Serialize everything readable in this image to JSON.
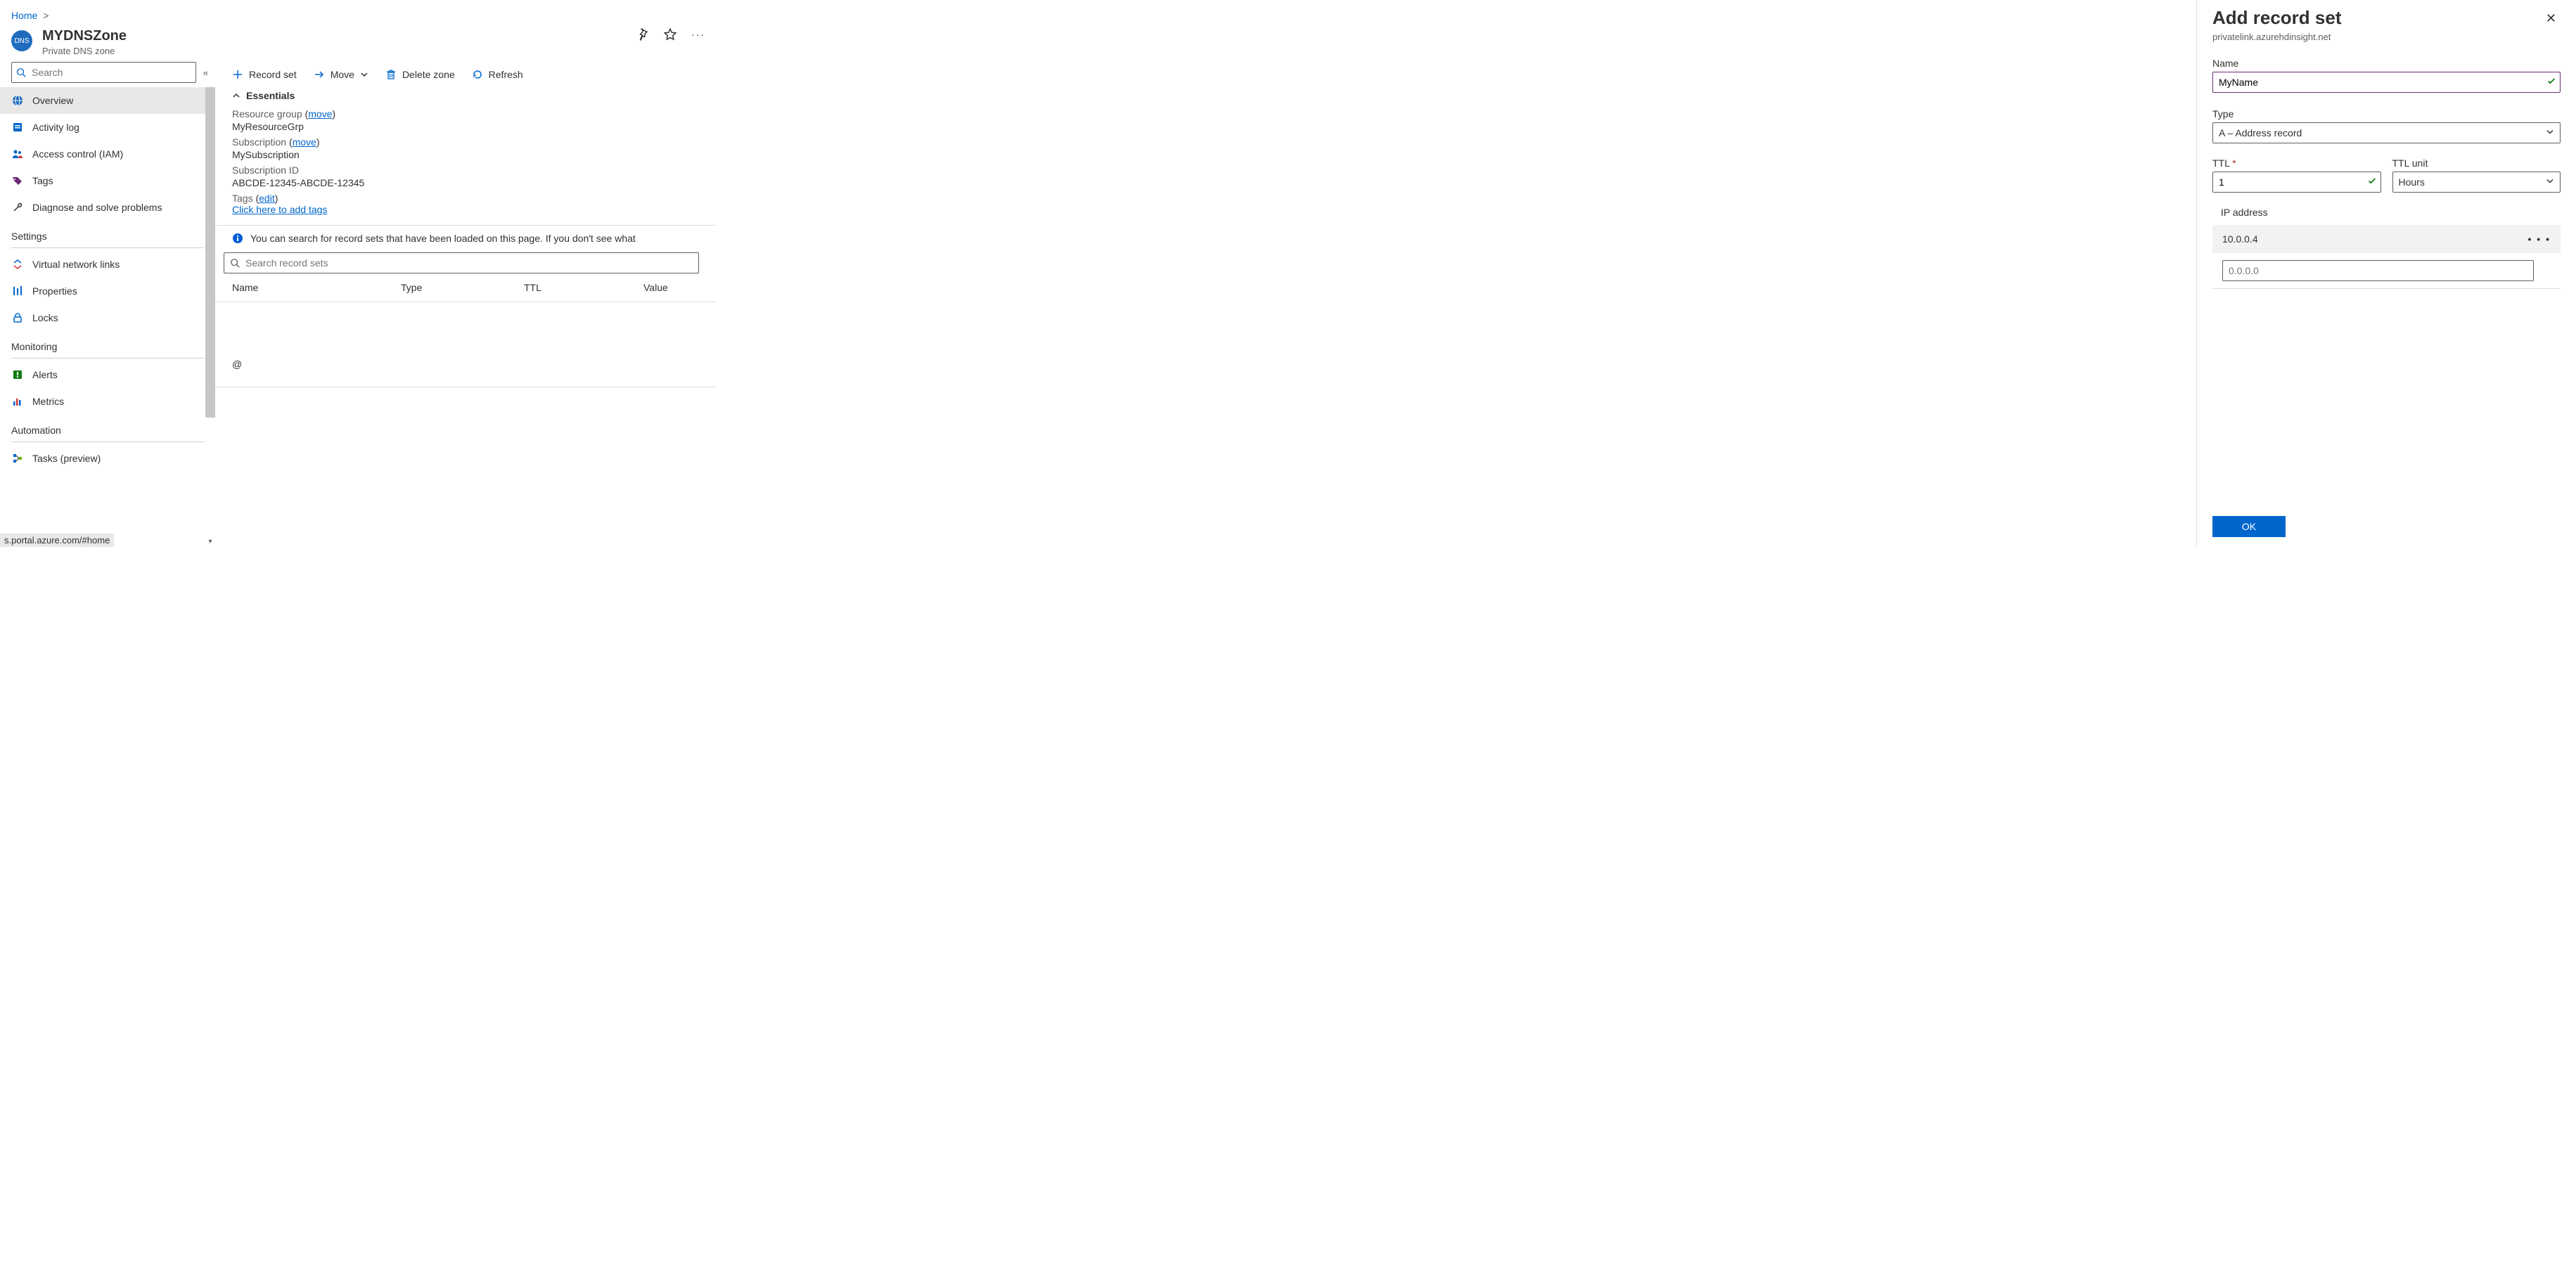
{
  "breadcrumb": {
    "home": "Home"
  },
  "resource": {
    "title": "MYDNSZone",
    "subtitle": "Private DNS zone",
    "badge": "DNS"
  },
  "sidebar": {
    "search_placeholder": "Search",
    "items": {
      "overview": "Overview",
      "activity": "Activity log",
      "iam": "Access control (IAM)",
      "tags": "Tags",
      "diagnose": "Diagnose and solve problems"
    },
    "sections": {
      "settings": "Settings",
      "monitoring": "Monitoring",
      "automation": "Automation"
    },
    "settings_items": {
      "vnet": "Virtual network links",
      "properties": "Properties",
      "locks": "Locks"
    },
    "monitoring_items": {
      "alerts": "Alerts",
      "metrics": "Metrics"
    },
    "automation_items": {
      "tasks": "Tasks (preview)"
    }
  },
  "toolbar": {
    "record_set": "Record set",
    "move": "Move",
    "delete": "Delete zone",
    "refresh": "Refresh"
  },
  "essentials": {
    "heading": "Essentials",
    "rg_label": "Resource group",
    "rg_value": "MyResourceGrp",
    "sub_label": "Subscription",
    "sub_value": "MySubscription",
    "subid_label": "Subscription ID",
    "subid_value": "ABCDE-12345-ABCDE-12345",
    "tags_label": "Tags",
    "move_link": "move",
    "edit_link": "edit",
    "add_tags": "Click here to add tags"
  },
  "info_msg": "You can search for record sets that have been loaded on this page. If you don't see what",
  "record_search_placeholder": "Search record sets",
  "columns": {
    "name": "Name",
    "type": "Type",
    "ttl": "TTL",
    "value": "Value"
  },
  "at_symbol": "@",
  "panel": {
    "title": "Add record set",
    "subtitle": "privatelink.azurehdinsight.net",
    "name_label": "Name",
    "name_value": "MyName",
    "type_label": "Type",
    "type_value": "A – Address record",
    "ttl_label": "TTL",
    "ttl_value": "1",
    "ttlunit_label": "TTL unit",
    "ttlunit_value": "Hours",
    "ip_label": "IP address",
    "ip_value_1": "10.0.0.4",
    "ip_placeholder": "0.0.0.0",
    "ok": "OK"
  },
  "status_url": "s.portal.azure.com/#home"
}
